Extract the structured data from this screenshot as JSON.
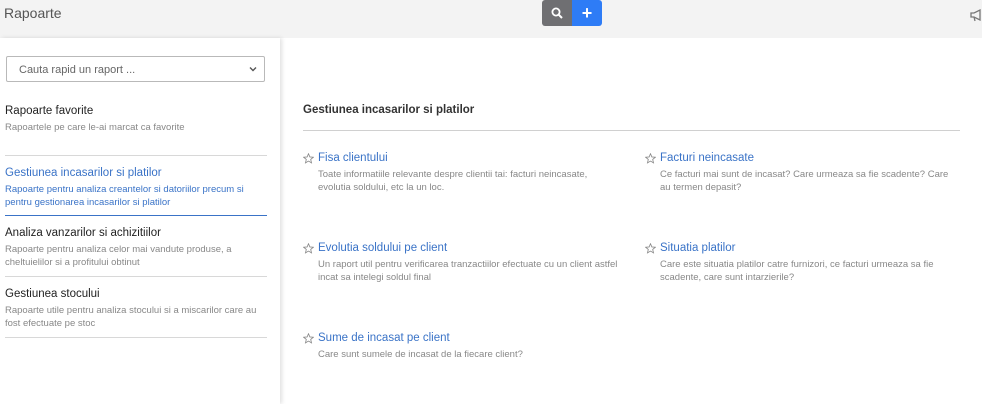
{
  "app": {
    "title": "Rapoarte"
  },
  "toolbar": {
    "search_icon": "search-icon",
    "add_label": "+",
    "notify_icon": "megaphone-icon"
  },
  "search": {
    "placeholder": "Cauta rapid un raport ..."
  },
  "sidebar": {
    "categories": [
      {
        "title": "Rapoarte favorite",
        "description": "Rapoartele pe care le-ai marcat ca favorite",
        "active": false
      },
      {
        "title": "Gestiunea incasarilor si platilor",
        "description": "Rapoarte pentru analiza creantelor si datoriilor precum si pentru gestionarea incasarilor si platilor",
        "active": true
      },
      {
        "title": "Analiza vanzarilor si achizitiilor",
        "description": "Rapoarte pentru analiza celor mai vandute produse, a cheltuielilor si a profitului obtinut",
        "active": false
      },
      {
        "title": "Gestiunea stocului",
        "description": "Rapoarte utile pentru analiza stocului si a miscarilor care au fost efectuate pe stoc",
        "active": false
      }
    ]
  },
  "main": {
    "section_title": "Gestiunea incasarilor si platilor",
    "reports": [
      {
        "title": "Fisa clientului",
        "description": "Toate informatiile relevante despre clientii tai: facturi neincasate, evolutia soldului, etc la un loc."
      },
      {
        "title": "Facturi neincasate",
        "description": "Ce facturi mai sunt de incasat? Care urmeaza sa fie scadente? Care au termen depasit?"
      },
      {
        "title": "Evolutia soldului pe client",
        "description": "Un raport util pentru verificarea tranzactiilor efectuate cu un client astfel incat sa intelegi soldul final"
      },
      {
        "title": "Situatia platilor",
        "description": "Care este situatia platilor catre furnizori, ce facturi urmeaza sa fie scadente, care sunt intarzierile?"
      },
      {
        "title": "Sume de incasat pe client",
        "description": "Care sunt sumele de incasat de la fiecare client?"
      }
    ]
  }
}
